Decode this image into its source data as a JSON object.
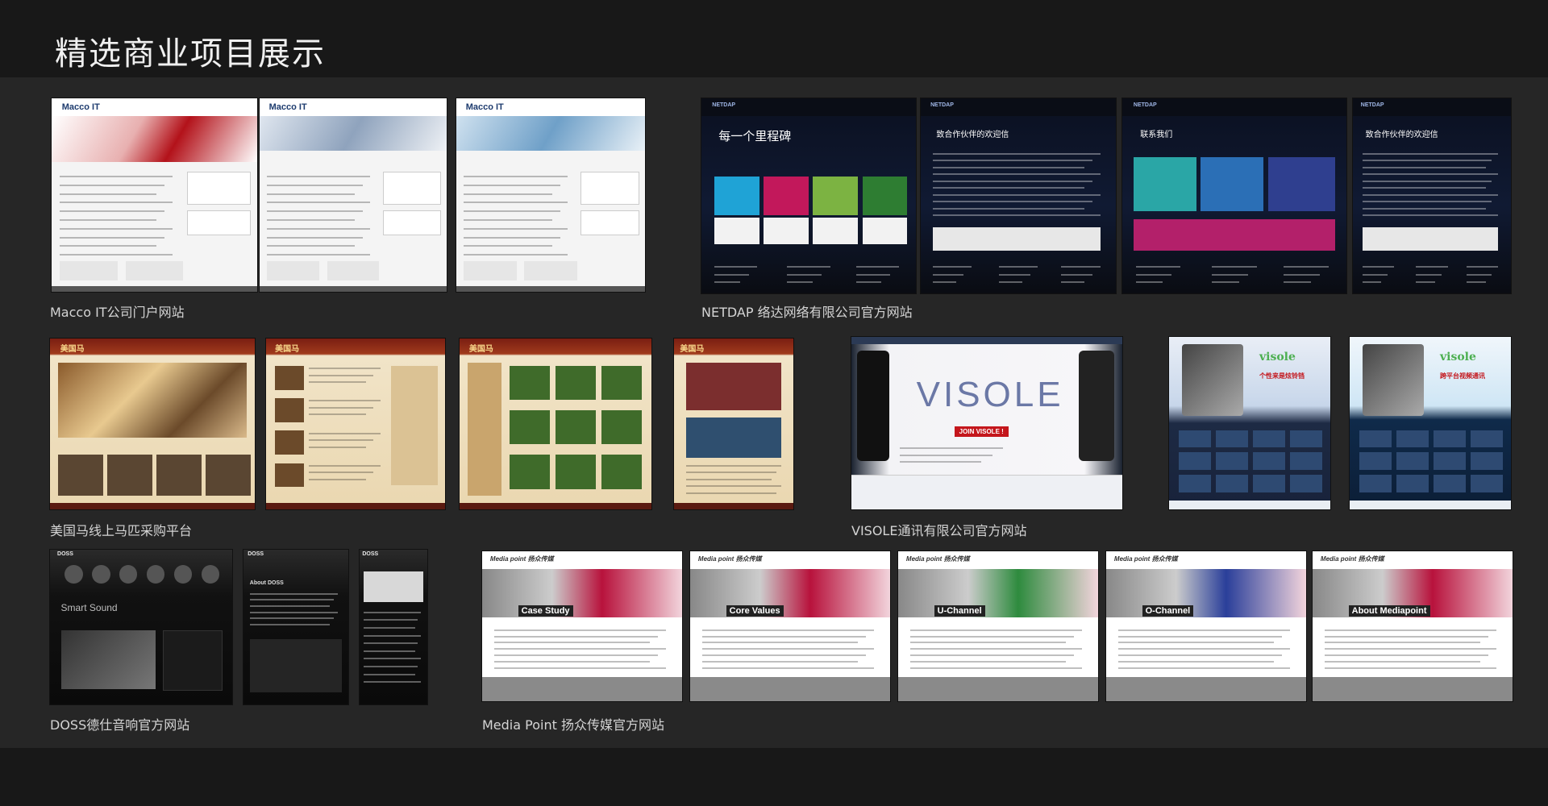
{
  "title": "精选商业项目展示",
  "colors": {
    "background": "#262626",
    "header": "#181818",
    "text": "#d4d4d4"
  },
  "projects": [
    {
      "caption": "Macco IT公司门户网站",
      "thumbs": [
        {
          "brand": "Macco IT",
          "theme": "macco"
        },
        {
          "brand": "Macco IT",
          "theme": "macco2"
        },
        {
          "brand": "Macco IT",
          "theme": "macco3"
        }
      ]
    },
    {
      "caption": "NETDAP 络达网络有限公司官方网站",
      "thumbs": [
        {
          "brand": "NETDAP",
          "text": "每一个里程碑",
          "theme": "netdap"
        },
        {
          "brand": "NETDAP",
          "text": "致合作伙伴的欢迎信",
          "theme": "netdap2"
        },
        {
          "brand": "NETDAP",
          "text": "联系我们",
          "theme": "netdap3"
        },
        {
          "brand": "NETDAP",
          "text": "致合作伙伴的欢迎信",
          "theme": "netdap4"
        }
      ]
    },
    {
      "caption": "美国马线上马匹采购平台",
      "thumbs": [
        {
          "brand": "美国马",
          "theme": "horse"
        },
        {
          "brand": "美国马",
          "theme": "horse"
        },
        {
          "brand": "美国马",
          "theme": "horse"
        },
        {
          "brand": "美国马",
          "theme": "horse"
        }
      ]
    },
    {
      "caption": "VISOLE通讯有限公司官方网站",
      "thumbs": [
        {
          "brand": "VISOLE",
          "text": "JOIN VISOLE !",
          "theme": "visole"
        },
        {
          "brand": "visole",
          "text": "个性来是炫铃铛",
          "theme": "visole2"
        },
        {
          "brand": "visole",
          "text": "跨平台视频通讯",
          "theme": "visole3"
        }
      ]
    },
    {
      "caption": "DOSS德仕音响官方网站",
      "thumbs": [
        {
          "brand": "DOSS",
          "text": "Smart Sound",
          "theme": "doss"
        },
        {
          "brand": "DOSS",
          "text": "About DOSS",
          "theme": "doss2"
        },
        {
          "brand": "DOSS",
          "theme": "doss3"
        }
      ]
    },
    {
      "caption": "Media Point 扬众传媒官方网站",
      "thumbs": [
        {
          "brand": "Media point 扬众传媒",
          "text": "Case Study",
          "theme": "media"
        },
        {
          "brand": "Media point 扬众传媒",
          "text": "Core Values",
          "theme": "media"
        },
        {
          "brand": "Media point 扬众传媒",
          "text": "U-Channel",
          "theme": "media-green"
        },
        {
          "brand": "Media point 扬众传媒",
          "text": "O-Channel",
          "theme": "media-blue"
        },
        {
          "brand": "Media point 扬众传媒",
          "text": "About Mediapoint",
          "theme": "media"
        }
      ]
    }
  ]
}
